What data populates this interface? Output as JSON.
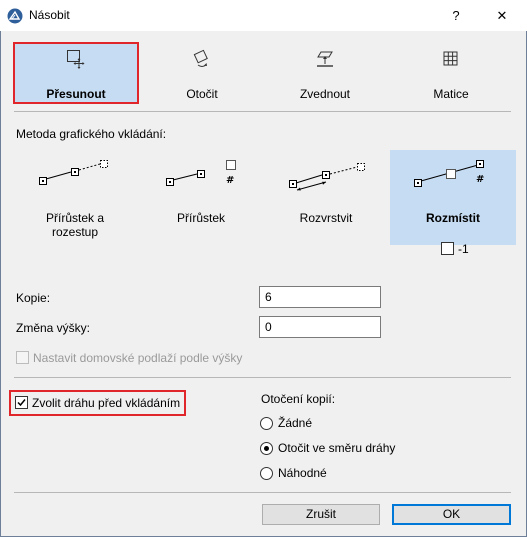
{
  "window": {
    "title": "Násobit",
    "help_label": "?",
    "close_label": "✕"
  },
  "tabs": [
    {
      "label": "Přesunout",
      "icon": "move-icon",
      "selected": true
    },
    {
      "label": "Otočit",
      "icon": "rotate-icon",
      "selected": false
    },
    {
      "label": "Zvednout",
      "icon": "elevate-icon",
      "selected": false
    },
    {
      "label": "Matice",
      "icon": "matrix-icon",
      "selected": false
    }
  ],
  "method": {
    "heading": "Metoda grafického vkládání:",
    "options": [
      {
        "label_line1": "Přírůstek a",
        "label_line2": "rozestup",
        "icon": "increment-spacing-icon",
        "selected": false
      },
      {
        "label_line1": "Přírůstek",
        "label_line2": "",
        "icon": "increment-icon",
        "selected": false
      },
      {
        "label_line1": "Rozvrstvit",
        "label_line2": "",
        "icon": "spread-icon",
        "selected": false
      },
      {
        "label_line1": "Rozmístit",
        "label_line2": "",
        "icon": "distribute-icon",
        "selected": true
      }
    ],
    "minus_one_label": "-1",
    "minus_one_checked": false
  },
  "fields": {
    "copies_label": "Kopie:",
    "copies_value": "6",
    "height_change_label": "Změna výšky:",
    "height_change_value": "0",
    "home_story_label": "Nastavit domovské podlaží podle výšky",
    "home_story_enabled": false
  },
  "path": {
    "label": "Zvolit dráhu před vkládáním",
    "checked": true
  },
  "rotation": {
    "heading": "Otočení kopií:",
    "options": [
      {
        "label": "Žádné",
        "selected": false
      },
      {
        "label": "Otočit ve směru dráhy",
        "selected": true
      },
      {
        "label": "Náhodné",
        "selected": false
      }
    ]
  },
  "buttons": {
    "cancel_label": "Zrušit",
    "ok_label": "OK"
  },
  "colors": {
    "selection": "#c6dcf2",
    "highlight_border": "#e0262b",
    "default_button_border": "#0078d7"
  }
}
